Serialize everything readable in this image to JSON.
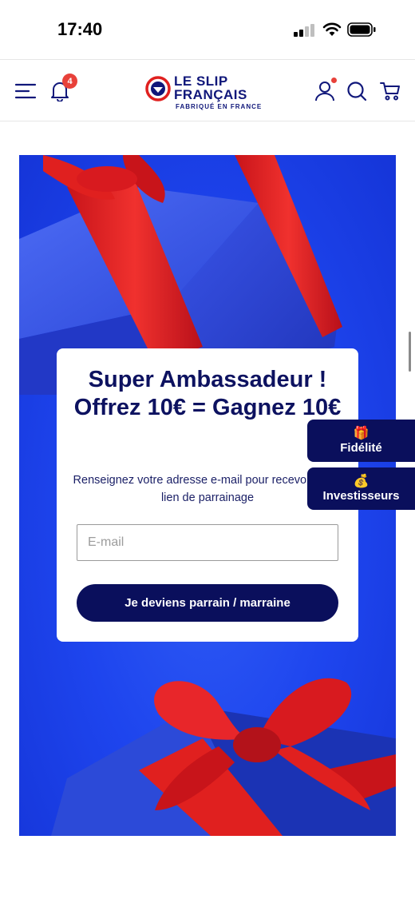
{
  "status_bar": {
    "time": "17:40"
  },
  "header": {
    "notification_count": "4",
    "logo": {
      "line1": "LE SLIP",
      "line2": "FRANÇAIS",
      "tagline": "FABRIQUÉ EN FRANCE"
    },
    "icons": [
      "menu-icon",
      "bell-icon",
      "user-icon",
      "search-icon",
      "cart-icon"
    ]
  },
  "card": {
    "title": "Super Ambassadeur ! Offrez 10€ = Gagnez 10€",
    "description": "Renseignez votre adresse e-mail pour recevoir votre lien de parrainage",
    "email_placeholder": "E-mail",
    "email_value": "",
    "submit_label": "Je deviens parrain / marraine"
  },
  "floating_tabs": [
    {
      "emoji": "🎁",
      "label": "Fidélité"
    },
    {
      "emoji": "💰",
      "label": "Investisseurs"
    }
  ],
  "colors": {
    "navy": "#0a0f5c",
    "brand_blue": "#10177a",
    "hero_blue": "#1e45ee",
    "ribbon_red": "#e0201f",
    "badge_red": "#e8413a"
  }
}
